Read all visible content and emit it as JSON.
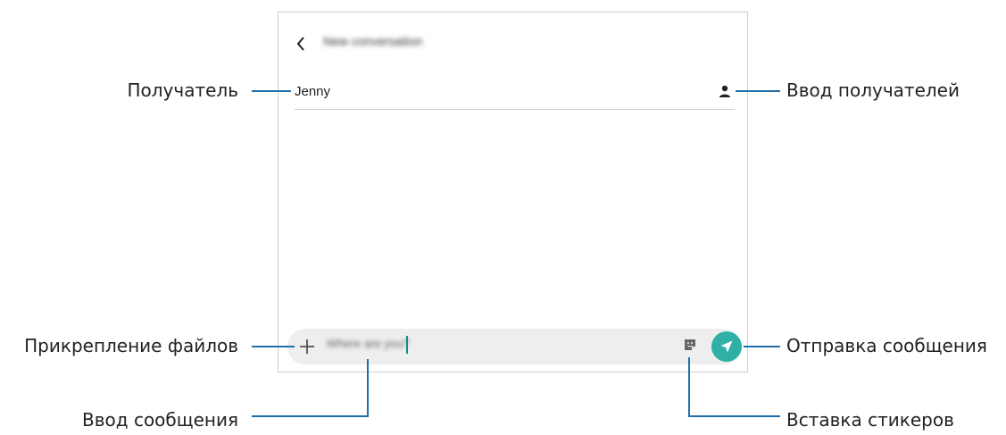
{
  "screen": {
    "title": "New conversation",
    "recipient": "Jenny",
    "message_input": "Where are you?"
  },
  "icons": {
    "back": "chevron-left-icon",
    "contacts": "person-icon",
    "attach": "plus-icon",
    "sticker": "sticker-icon",
    "send": "send-icon"
  },
  "callouts": {
    "recipient": "Получатель",
    "attach": "Прикрепление файлов",
    "compose": "Ввод сообщения",
    "add_recipients": "Ввод получателей",
    "send": "Отправка сообщения",
    "stickers": "Вставка стикеров"
  },
  "colors": {
    "accent": "#2fb0a6",
    "callout_line": "#1f6fa8"
  }
}
